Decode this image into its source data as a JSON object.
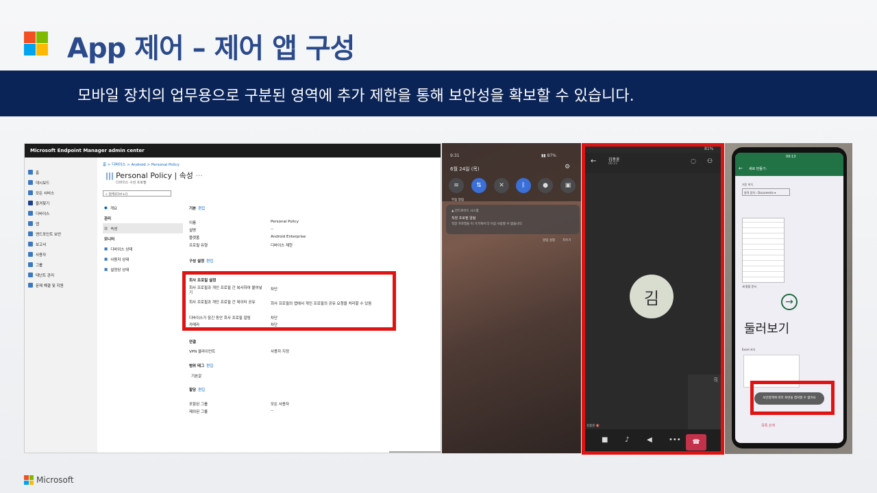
{
  "slide": {
    "title": "App 제어 – 제어 앱 구성",
    "banner": "모바일 장치의 업무용으로 구분된 영역에 추가 제한을 통해 보안성을 확보할 수 있습니다.",
    "footer_brand": "Microsoft",
    "logo_colors": [
      "#f25022",
      "#7fba00",
      "#00a4ef",
      "#ffb900"
    ]
  },
  "mem": {
    "app_title": "Microsoft Endpoint Manager admin center",
    "nav": [
      "홈",
      "대시보드",
      "모든 서비스",
      "즐겨찾기",
      "디바이스",
      "앱",
      "엔드포인트 보안",
      "보고서",
      "사용자",
      "그룹",
      "테넌트 관리",
      "문제 해결 및 지원"
    ],
    "breadcrumb": "홈 > 디바이스 > Android > Personal Policy",
    "page_title": "Personal Policy | 속성",
    "page_subtitle": "디바이스 구성 프로필",
    "search_placeholder": "검색(Ctrl+/)",
    "menu": {
      "overview": "개요",
      "manage": "관리",
      "properties": "속성",
      "monitor": "모니터",
      "device_status": "디바이스 상태",
      "user_status": "사용자 상태",
      "assign_status": "설정당 상태"
    },
    "edit": "편집",
    "basic": {
      "header": "기본",
      "rows": [
        [
          "이름",
          "Personal Policy"
        ],
        [
          "설명",
          "--"
        ],
        [
          "플랫폼",
          "Android Enterprise"
        ],
        [
          "프로필 유형",
          "디바이스 제한"
        ]
      ]
    },
    "config_header": "구성 설정",
    "work_profile": {
      "header": "회사 프로필 설정",
      "rows": [
        [
          "회사 프로필과 개인 프로필 간 복사하여 붙여넣기",
          "차단"
        ],
        [
          "회사 프로필과 개인 프로필 간 데이터 공유",
          "회사 프로필의 앱에서 개인 프로필의 공유 요청을 처리할 수 있음"
        ],
        [
          "디바이스가 잠긴 동안 회사 프로필 알림",
          "차단"
        ],
        [
          "카메라",
          "차단"
        ]
      ]
    },
    "connectivity": {
      "header": "연결",
      "rows": [
        [
          "VPN 클라이언트",
          "사용자 지정"
        ]
      ]
    },
    "scope": {
      "header": "범위 태그",
      "value": "기본값"
    },
    "assign": {
      "header": "할당",
      "rows": [
        [
          "포함된 그룹",
          "모든 사용자"
        ],
        [
          "제외된 그룹",
          "--"
        ]
      ]
    }
  },
  "phone1": {
    "time": "9:31",
    "status": "87%",
    "date": "6월 24일 (목)",
    "silent": "무음 알림",
    "notif_app": "안드로이드 시스템",
    "notif_title": "직장 프로필 알림",
    "notif_body": "직장 프로필을 이 기기에서 더 이상 사용할 수 없습니다.",
    "btn_settings": "알림 설정",
    "btn_clear": "지우기"
  },
  "phone2": {
    "battery": "81%",
    "caller": "김종훈",
    "duration": "00:15",
    "avatar_initial": "김",
    "self_label": "김종훈 🔇"
  },
  "phone3": {
    "time": "09:13",
    "new_title": "새로 만들기:",
    "save_label": "저장 위치",
    "save_path": "원격 장치 › Documents",
    "blank": "새 통합 문서",
    "browse": "둘러보기",
    "excel": "Excel 서식",
    "toast": "보안정책에 따라 화면을 캡처할 수 없어요",
    "footer": "목록 관계"
  }
}
